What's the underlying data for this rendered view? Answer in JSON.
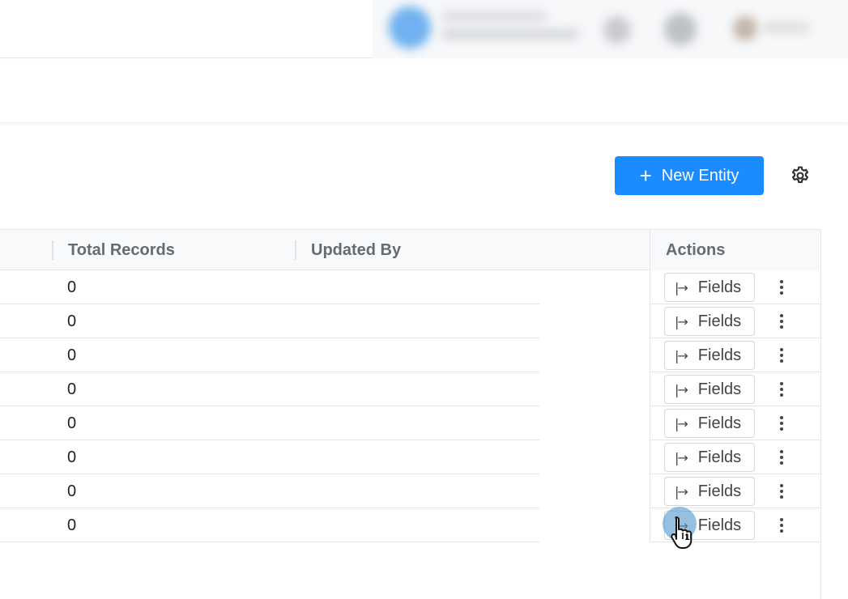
{
  "toolbar": {
    "new_entity_label": "New Entity"
  },
  "icons": {
    "plus": "+",
    "fields_arrow": "|→",
    "settings": "gear-icon"
  },
  "table": {
    "columns": [
      "Total Records",
      "Updated By",
      "Actions"
    ],
    "action_label": "Fields",
    "rows": [
      {
        "total_records": "0",
        "updated_by": ""
      },
      {
        "total_records": "0",
        "updated_by": ""
      },
      {
        "total_records": "0",
        "updated_by": ""
      },
      {
        "total_records": "0",
        "updated_by": ""
      },
      {
        "total_records": "0",
        "updated_by": ""
      },
      {
        "total_records": "0",
        "updated_by": ""
      },
      {
        "total_records": "0",
        "updated_by": ""
      },
      {
        "total_records": "0",
        "updated_by": ""
      }
    ]
  },
  "cursor": {
    "click_count": "1"
  },
  "colors": {
    "primary": "#1a8cff",
    "header_bg": "#f8f9fb",
    "border": "#e3e5e8"
  }
}
